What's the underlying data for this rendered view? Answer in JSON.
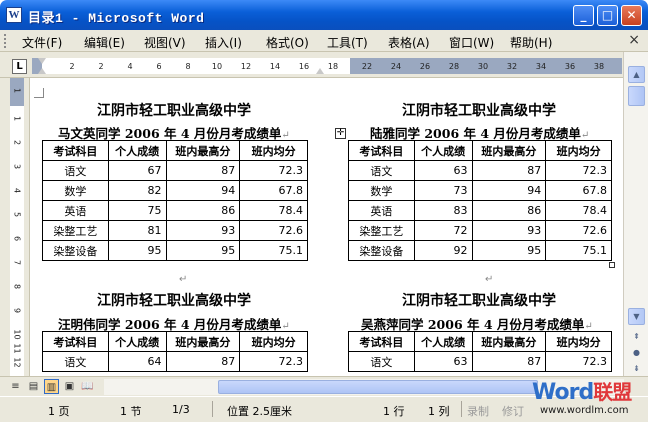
{
  "window": {
    "icon_letter": "W",
    "title": "目录1 - Microsoft Word",
    "minimize": "_",
    "maximize": "□",
    "close": "✕"
  },
  "menu": {
    "items": [
      "文件(F)",
      "编辑(E)",
      "视图(V)",
      "插入(I)",
      "格式(O)",
      "工具(T)",
      "表格(A)",
      "窗口(W)",
      "帮助(H)"
    ],
    "close_doc": "×"
  },
  "ruler": {
    "tab_selector": "L",
    "numbers": [
      "2",
      "2",
      "4",
      "6",
      "8",
      "10",
      "12",
      "14",
      "16",
      "18",
      "22",
      "24",
      "26",
      "28",
      "30",
      "32",
      "34",
      "36",
      "38"
    ],
    "vertical_numbers": [
      "1",
      "1",
      "2",
      "3",
      "4",
      "5",
      "6",
      "7",
      "8",
      "9",
      "10",
      "11",
      "12"
    ]
  },
  "document": {
    "blocks": [
      {
        "school": "江阴市轻工职业高级中学",
        "title": "马文英同学 2006 年 4 月份月考成绩单",
        "headers": [
          "考试科目",
          "个人成绩",
          "班内最高分",
          "班内均分"
        ],
        "rows": [
          [
            "语文",
            "67",
            "87",
            "72.3"
          ],
          [
            "数学",
            "82",
            "94",
            "67.8"
          ],
          [
            "英语",
            "75",
            "86",
            "78.4"
          ],
          [
            "染整工艺",
            "81",
            "93",
            "72.6"
          ],
          [
            "染整设备",
            "95",
            "95",
            "75.1"
          ]
        ]
      },
      {
        "school": "江阴市轻工职业高级中学",
        "title": "陆雅同学 2006 年 4 月份月考成绩单",
        "headers": [
          "考试科目",
          "个人成绩",
          "班内最高分",
          "班内均分"
        ],
        "rows": [
          [
            "语文",
            "63",
            "87",
            "72.3"
          ],
          [
            "数学",
            "73",
            "94",
            "67.8"
          ],
          [
            "英语",
            "83",
            "86",
            "78.4"
          ],
          [
            "染整工艺",
            "72",
            "93",
            "72.6"
          ],
          [
            "染整设备",
            "92",
            "95",
            "75.1"
          ]
        ]
      },
      {
        "school": "江阴市轻工职业高级中学",
        "title": "汪明伟同学 2006 年 4 月份月考成绩单",
        "headers": [
          "考试科目",
          "个人成绩",
          "班内最高分",
          "班内均分"
        ],
        "rows": [
          [
            "语文",
            "64",
            "87",
            "72.3"
          ]
        ]
      },
      {
        "school": "江阴市轻工职业高级中学",
        "title": "吴燕萍同学 2006 年 4 月份月考成绩单",
        "headers": [
          "考试科目",
          "个人成绩",
          "班内最高分",
          "班内均分"
        ],
        "rows": [
          [
            "语文",
            "63",
            "87",
            "72.3"
          ]
        ]
      }
    ],
    "para_mark": "↵",
    "move_handle": "✛"
  },
  "scrollbar": {
    "up": "▲",
    "down": "▼",
    "prev_page": "⇞",
    "select_browse": "●",
    "next_page": "⇟"
  },
  "view_buttons": [
    "≡",
    "▤",
    "▥",
    "▣",
    "📖"
  ],
  "status": {
    "page": "1 页",
    "section": "1 节",
    "page_of": "1/3",
    "position": "位置 2.5厘米",
    "line": "1 行",
    "column": "1 列",
    "rec": "录制",
    "trk": "修订"
  },
  "watermark": {
    "logo_en": "Word",
    "logo_cn": "联盟",
    "url": "www.wordlm.com"
  }
}
